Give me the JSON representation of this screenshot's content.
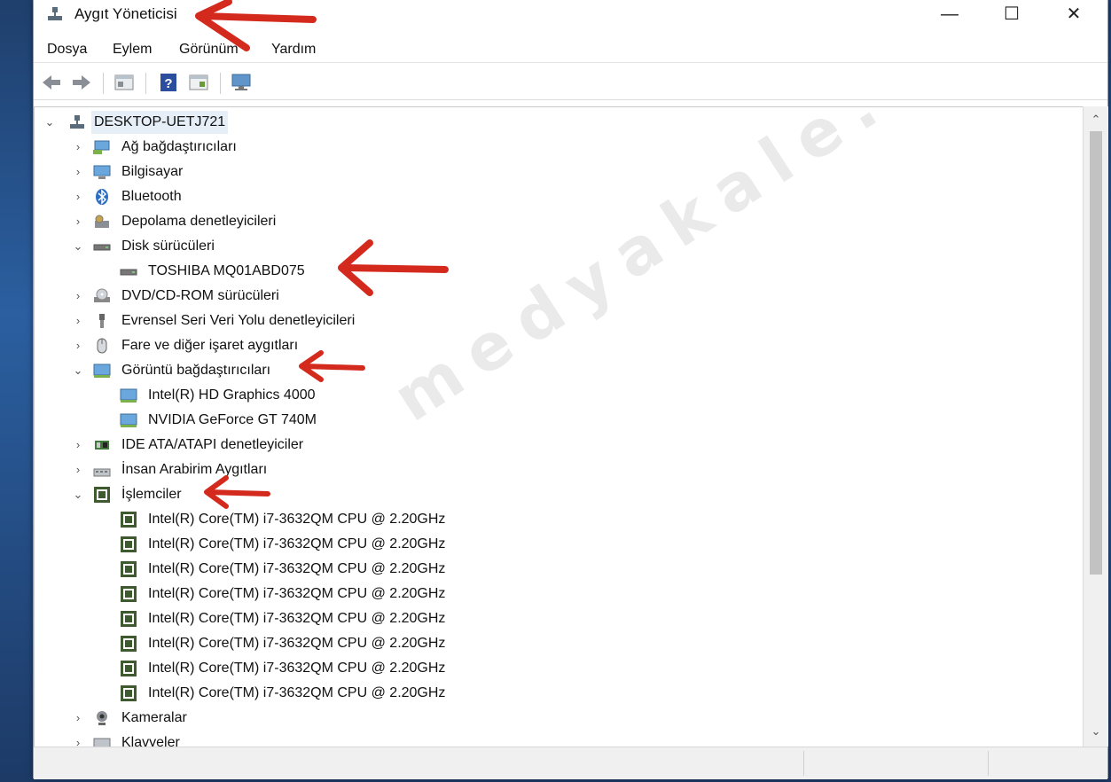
{
  "window": {
    "title": "Aygıt Yöneticisi",
    "controls": {
      "minimize": "—",
      "maximize": "☐",
      "close": "✕"
    }
  },
  "menu": [
    "Dosya",
    "Eylem",
    "Görünüm",
    "Yardım"
  ],
  "toolbar": [
    "back-icon",
    "forward-icon",
    "properties-icon",
    "help-icon",
    "details-view-icon",
    "monitor-scan-icon"
  ],
  "tree": {
    "root": "DESKTOP-UETJ721",
    "items": [
      {
        "label": "Ağ bağdaştırıcıları",
        "expanded": false,
        "icon": "network-adapter-icon"
      },
      {
        "label": "Bilgisayar",
        "expanded": false,
        "icon": "computer-icon"
      },
      {
        "label": "Bluetooth",
        "expanded": false,
        "icon": "bluetooth-icon"
      },
      {
        "label": "Depolama denetleyicileri",
        "expanded": false,
        "icon": "storage-controller-icon"
      },
      {
        "label": "Disk sürücüleri",
        "expanded": true,
        "icon": "disk-drive-icon",
        "children": [
          "TOSHIBA MQ01ABD075"
        ]
      },
      {
        "label": "DVD/CD-ROM sürücüleri",
        "expanded": false,
        "icon": "dvd-drive-icon"
      },
      {
        "label": "Evrensel Seri Veri Yolu denetleyicileri",
        "expanded": false,
        "icon": "usb-icon"
      },
      {
        "label": "Fare ve diğer işaret aygıtları",
        "expanded": false,
        "icon": "mouse-icon"
      },
      {
        "label": "Görüntü bağdaştırıcıları",
        "expanded": true,
        "icon": "display-adapter-icon",
        "children": [
          "Intel(R) HD Graphics 4000",
          "NVIDIA GeForce GT 740M"
        ]
      },
      {
        "label": "IDE ATA/ATAPI denetleyiciler",
        "expanded": false,
        "icon": "ide-controller-icon"
      },
      {
        "label": "İnsan Arabirim Aygıtları",
        "expanded": false,
        "icon": "hid-icon"
      },
      {
        "label": "İşlemciler",
        "expanded": true,
        "icon": "processor-icon",
        "children": [
          "Intel(R) Core(TM) i7-3632QM CPU @ 2.20GHz",
          "Intel(R) Core(TM) i7-3632QM CPU @ 2.20GHz",
          "Intel(R) Core(TM) i7-3632QM CPU @ 2.20GHz",
          "Intel(R) Core(TM) i7-3632QM CPU @ 2.20GHz",
          "Intel(R) Core(TM) i7-3632QM CPU @ 2.20GHz",
          "Intel(R) Core(TM) i7-3632QM CPU @ 2.20GHz",
          "Intel(R) Core(TM) i7-3632QM CPU @ 2.20GHz",
          "Intel(R) Core(TM) i7-3632QM CPU @ 2.20GHz"
        ]
      },
      {
        "label": "Kameralar",
        "expanded": false,
        "icon": "camera-icon"
      },
      {
        "label": "Klavyeler",
        "expanded": false,
        "icon": "keyboard-icon"
      }
    ]
  },
  "scrollbar": {
    "up": "⌃",
    "down": "⌄"
  },
  "annotation_color": "#d42a1e",
  "watermark": "medyakale.com"
}
